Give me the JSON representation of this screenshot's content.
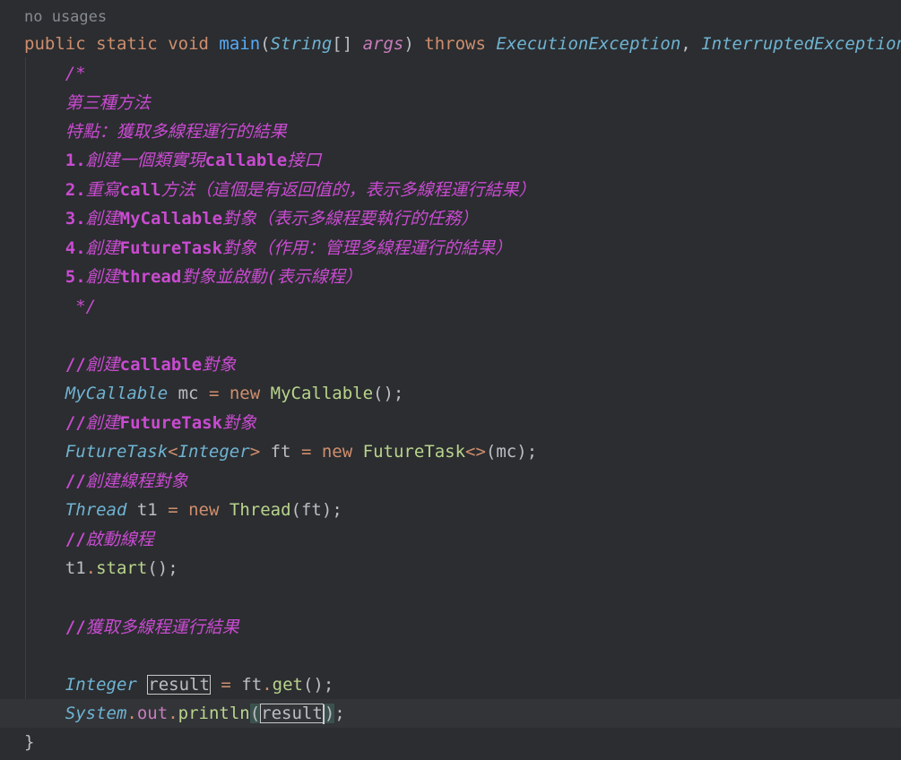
{
  "usage_hint": "no usages",
  "signature": {
    "kw_public": "public",
    "kw_static": "static",
    "kw_void": "void",
    "method": "main",
    "paren_open": "(",
    "param_type": "String",
    "brackets": "[]",
    "param_name": "args",
    "paren_close": ")",
    "kw_throws": "throws",
    "exception1": "ExecutionException",
    "comma": ",",
    "exception2": "InterruptedException",
    "brace_open": "{"
  },
  "doc_comment": {
    "open": "/*",
    "line1": "第三種方法",
    "line2": "特點：獲取多線程運行的結果",
    "step1": {
      "num": "1.",
      "pre": "創建一個類實現",
      "code": "callable",
      "post": "接口"
    },
    "step2": {
      "num": "2.",
      "pre": "重寫",
      "code": "call",
      "post": "方法（這個是有返回值的，表示多線程運行結果）"
    },
    "step3": {
      "num": "3.",
      "pre": "創建",
      "code": "MyCallable",
      "post": "對象（表示多線程要執行的任務）"
    },
    "step4": {
      "num": "4.",
      "pre": "創建",
      "code": "FutureTask",
      "post": "對象（作用：管理多線程運行的結果）"
    },
    "step5": {
      "num": "5.",
      "pre": "創建",
      "code": "thread",
      "post": "對象並啟動(表示線程）"
    },
    "close": " */"
  },
  "comments": {
    "c1": {
      "slash": "//",
      "pre": "創建",
      "code": "callable",
      "post": "對象"
    },
    "c2": {
      "slash": "//",
      "pre": "創建",
      "code": "FutureTask",
      "post": "對象"
    },
    "c3": {
      "slash": "//",
      "text": "創建線程對象"
    },
    "c4": {
      "slash": "//",
      "text": "啟動線程"
    },
    "c5": {
      "slash": "//",
      "text": "獲取多線程運行結果"
    }
  },
  "statements": {
    "s1": {
      "type": "MyCallable",
      "var": "mc",
      "eq": "=",
      "kw_new": "new",
      "ctor": "MyCallable",
      "tail": "();"
    },
    "s2": {
      "type": "FutureTask",
      "lt": "<",
      "generic": "Integer",
      "gt": ">",
      "var": "ft",
      "eq": "=",
      "kw_new": "new",
      "ctor": "FutureTask",
      "diamond": "<>",
      "open": "(",
      "arg": "mc",
      "tail": ");"
    },
    "s3": {
      "type": "Thread",
      "var": "t1",
      "eq": "=",
      "kw_new": "new",
      "ctor": "Thread",
      "open": "(",
      "arg": "ft",
      "tail": ");"
    },
    "s4": {
      "var": "t1",
      "dot": ".",
      "call": "start",
      "tail": "();"
    },
    "s5": {
      "type": "Integer",
      "var": "result",
      "eq": "=",
      "obj": "ft",
      "dot": ".",
      "call": "get",
      "tail": "();"
    },
    "s6": {
      "cls": "System",
      "dot1": ".",
      "field": "out",
      "dot2": ".",
      "call": "println",
      "open": "(",
      "arg": "result",
      "close": ")",
      "semi": ";"
    }
  },
  "closing_brace": "}",
  "colors": {
    "background": "#2b2d30",
    "keyword": "#cf8e6d",
    "comment": "#c94bd1",
    "type": "#6fb3d2",
    "class_ref": "#b9d48c",
    "method": "#56a8f5",
    "current_line": "#323438"
  }
}
